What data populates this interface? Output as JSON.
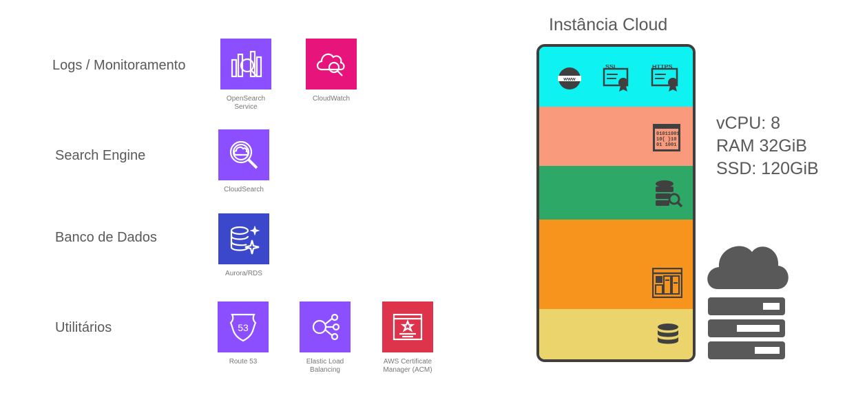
{
  "rows": [
    {
      "label": "Logs / Monitoramento"
    },
    {
      "label": "Search Engine"
    },
    {
      "label": "Banco de Dados"
    },
    {
      "label": "Utilitários"
    }
  ],
  "services": {
    "opensearch": {
      "caption": "OpenSearch\nService",
      "color": "#8C4FFF",
      "icon": "opensearch-icon"
    },
    "cloudwatch": {
      "caption": "CloudWatch",
      "color": "#E7157B",
      "icon": "cloudwatch-icon"
    },
    "cloudsearch": {
      "caption": "CloudSearch",
      "color": "#8C4FFF",
      "icon": "cloudsearch-icon"
    },
    "aurora": {
      "caption": "Aurora/RDS",
      "color": "#3B48CC",
      "icon": "aurora-icon"
    },
    "route53": {
      "caption": "Route 53",
      "color": "#8C4FFF",
      "icon": "route53-icon"
    },
    "elb": {
      "caption": "Elastic Load\nBalancing",
      "color": "#8C4FFF",
      "icon": "elb-icon"
    },
    "acm": {
      "caption": "AWS Certificate\nManager (ACM)",
      "color": "#DD344C",
      "icon": "acm-icon"
    }
  },
  "instance": {
    "title": "Instância Cloud",
    "border_color": "#3f3f3f",
    "bands": [
      {
        "name": "web-layer",
        "color": "#0EF2F2",
        "icons": [
          "www-icon",
          "ssl-certificate-icon",
          "https-certificate-icon"
        ]
      },
      {
        "name": "code-layer",
        "color": "#FA9A7C",
        "icons": [
          "binary-code-icon"
        ]
      },
      {
        "name": "search-layer",
        "color": "#2EA866",
        "icons": [
          "database-search-icon"
        ]
      },
      {
        "name": "app-layer",
        "color": "#F7941D",
        "icons": [
          "dashboard-window-icon"
        ]
      },
      {
        "name": "storage-layer",
        "color": "#EBD46C",
        "icons": [
          "database-icon"
        ]
      }
    ]
  },
  "specs": {
    "vcpu": "vCPU: 8",
    "ram": "RAM 32GiB",
    "ssd": "SSD: 120GiB"
  },
  "cloud_server_icon": {
    "icon": "cloud-server-icon",
    "color": "#595959"
  }
}
